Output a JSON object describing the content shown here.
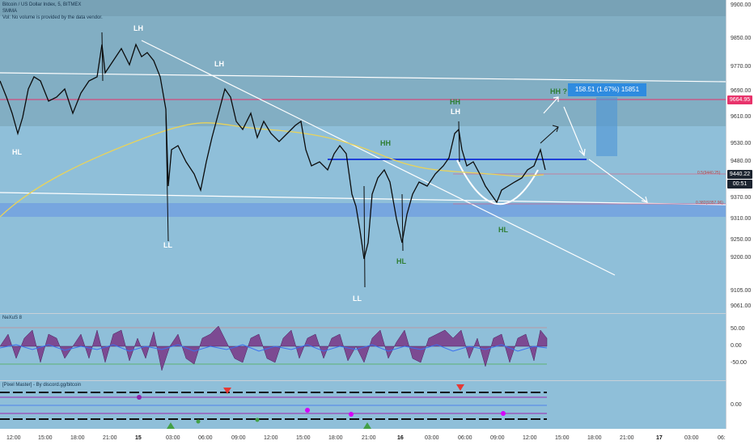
{
  "legend": {
    "line1": "Bitcoin / US Dollar Index, 5, BITMEX",
    "line2": "SMMA",
    "line3": "Vol: No volume is provided by the data vendor."
  },
  "yaxis": {
    "ticks": [
      "9900.00",
      "9850.00",
      "9770.00",
      "9690.00",
      "9610.00",
      "9530.00",
      "9480.00",
      "9370.00",
      "9310.00",
      "9250.00",
      "9200.00",
      "9105.00",
      "9061.00"
    ],
    "price_tag_red": "9664.95",
    "price_tag_dark": "9440.22",
    "countdown": "00:51"
  },
  "labels": {
    "lh1": "LH",
    "lh2": "LH",
    "lh3": "LH",
    "hh_top": "HH",
    "hl1": "HL",
    "ll1": "LL",
    "ll2": "LL",
    "hh_green": "HH",
    "hl_green1": "HL",
    "hl_green2": "HL",
    "hh_q": "HH ?"
  },
  "measure": "158.51 (1.67%) 15851",
  "fib_labels": {
    "a": "0.5(9440.25)",
    "b": "0.382(9357.96)"
  },
  "osc1": {
    "title": "NeXuS 8",
    "ticks": [
      "50.00",
      "0.00",
      "-50.00"
    ]
  },
  "osc2": {
    "title": "[Pixel Master] - By discord.gg/bitcoin",
    "ticks": [
      "0.00"
    ]
  },
  "xaxis": {
    "ticks": [
      "12:00",
      "15:00",
      "18:00",
      "21:00",
      "15",
      "03:00",
      "06:00",
      "09:00",
      "12:00",
      "15:00",
      "18:00",
      "21:00",
      "16",
      "03:00",
      "06:00",
      "09:00",
      "12:00",
      "15:00",
      "18:00",
      "21:00",
      "17",
      "03:00",
      "06:"
    ]
  },
  "colors": {
    "red_line": "#e8336b",
    "blue_line": "#1f3fd8",
    "smma": "#e9d35a",
    "candle": "#0b0b0b",
    "measure_bg": "#2e8be0"
  }
}
